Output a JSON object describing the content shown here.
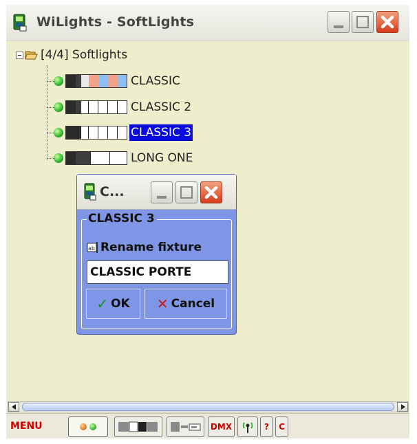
{
  "window": {
    "title": "WiLights - SoftLights",
    "icon": "fixture-app-icon",
    "controls": [
      "minimize-icon",
      "maximize-icon",
      "close-icon"
    ]
  },
  "tree": {
    "root_label": "[4/4] Softlights",
    "items": [
      {
        "label": "CLASSIC",
        "selected": false,
        "status_color": "#2db52d"
      },
      {
        "label": "CLASSIC 2",
        "selected": false,
        "status_color": "#2db52d"
      },
      {
        "label": "CLASSIC 3",
        "selected": true,
        "status_color": "#2db52d"
      },
      {
        "label": "LONG ONE",
        "selected": false,
        "status_color": "#2db52d"
      }
    ]
  },
  "dialog": {
    "title": "C...",
    "group_title": "CLASSIC 3",
    "rename_label": "Rename fixture",
    "input_value": "CLASSIC PORTE",
    "ok_label": "OK",
    "cancel_label": "Cancel"
  },
  "toolbar": {
    "menu_label": "MENU",
    "dmx_label": "DMX",
    "help_label": "?",
    "c_label": "C"
  },
  "colors": {
    "window_bg": "#eeeecc",
    "selection": "#0a0adf",
    "dialog_bg": "#7f95e6",
    "menu_text": "#cc0000"
  }
}
